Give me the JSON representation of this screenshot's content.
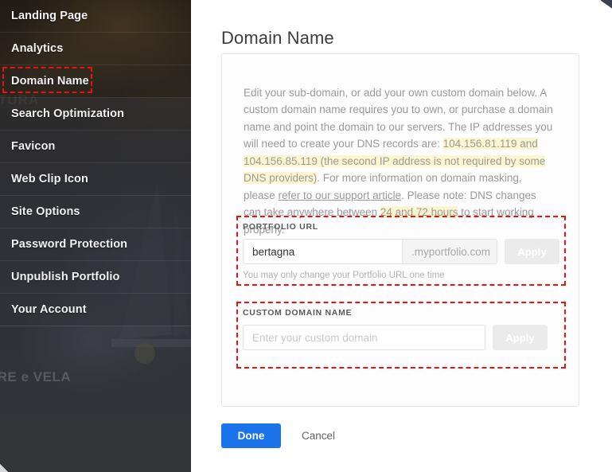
{
  "sidebar": {
    "background_caption_top": "ATURA",
    "background_caption_bottom": "ARE e VELA",
    "items": [
      {
        "label": "Landing Page"
      },
      {
        "label": "Analytics"
      },
      {
        "label": "Domain Name"
      },
      {
        "label": "Search Optimization"
      },
      {
        "label": "Favicon"
      },
      {
        "label": "Web Clip Icon"
      },
      {
        "label": "Site Options"
      },
      {
        "label": "Password Protection"
      },
      {
        "label": "Unpublish Portfolio"
      },
      {
        "label": "Your Account"
      }
    ]
  },
  "main": {
    "title": "Domain Name",
    "intro": {
      "seg1": "Edit your sub-domain, or add your own custom domain below. A custom domain name requires you to own, or purchase a domain name and point the domain to our servers. The IP addresses you will need to create your DNS records are: ",
      "hl1": "104.156.81.119 and 104.156.85.119 (the second IP address is not required by some DNS providers)",
      "seg2": ". For more information on domain masking, please ",
      "link": "refer to our support article",
      "seg3": ". Please note: DNS changes can take anywhere between ",
      "hl2": "24 and 72 hours",
      "seg4": " to start working properly."
    },
    "portfolio": {
      "legend": "PORTFOLIO URL",
      "value": "bertagna",
      "placeholder": "",
      "suffix": ".myportfolio.com",
      "apply_label": "Apply",
      "note": "You may only change your Portfolio URL one time"
    },
    "custom_domain": {
      "legend": "CUSTOM DOMAIN NAME",
      "value": "",
      "placeholder": "Enter your custom domain",
      "apply_label": "Apply"
    },
    "footer": {
      "done_label": "Done",
      "cancel_label": "Cancel"
    }
  },
  "colors": {
    "accent": "#1a73e8",
    "annotation": "#ee1111",
    "highlight": "#fbf6cf",
    "sidebar_bg": "#2f3136",
    "disabled_button": "#ebebeb"
  }
}
